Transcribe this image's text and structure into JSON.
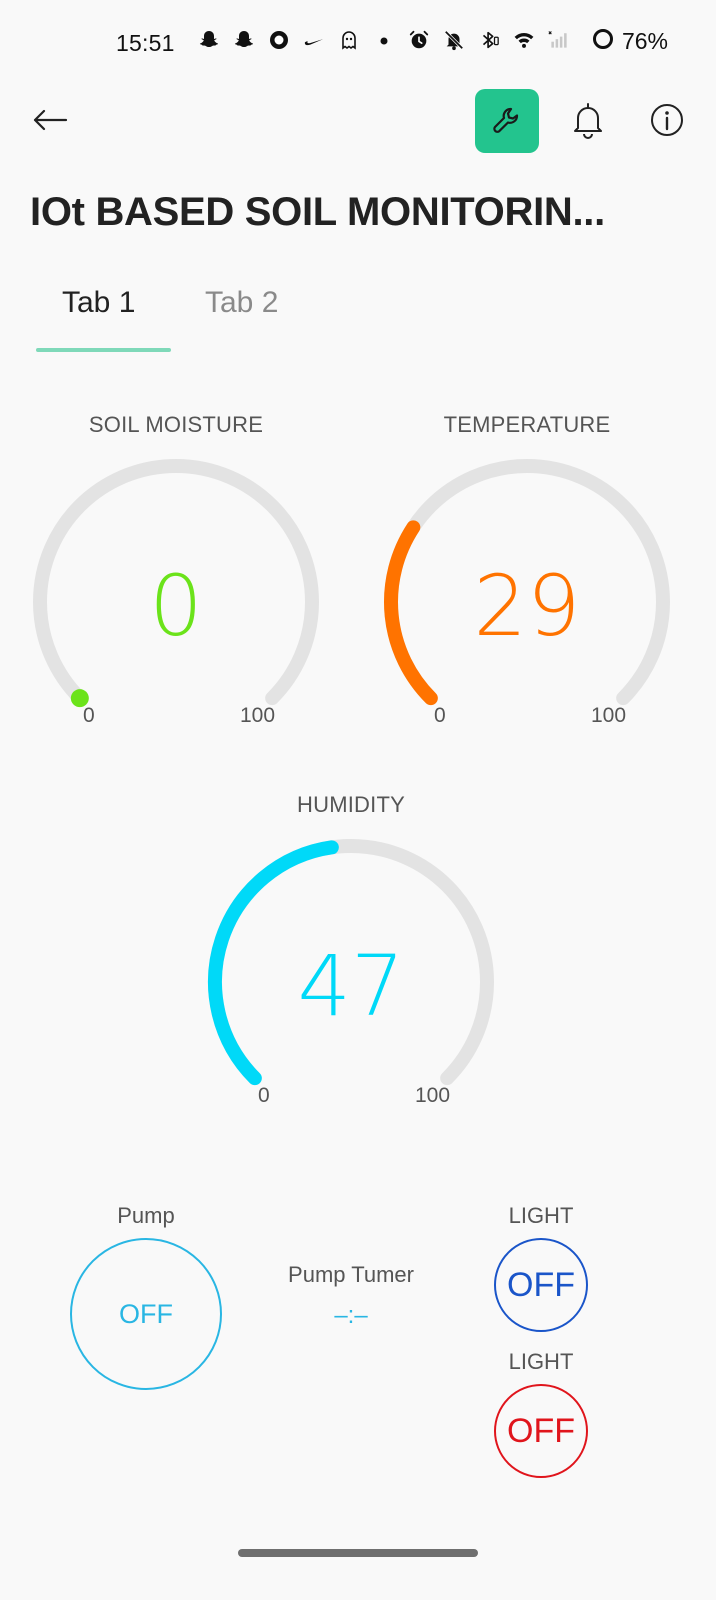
{
  "status_bar": {
    "time": "15:51",
    "battery": "76%",
    "icons": [
      "snapchat-icon",
      "snapchat-icon",
      "circle-app-icon",
      "nike-icon",
      "ghost-icon",
      "dot-icon",
      "alarm-icon",
      "bell-off-icon",
      "bluetooth-icon",
      "wifi-icon",
      "signal-icon",
      "battery-ring-icon"
    ]
  },
  "header": {
    "title": "IOt BASED SOIL MONITORIN...",
    "accent_color": "#23c48e"
  },
  "tabs": [
    {
      "label": "Tab 1",
      "active": true
    },
    {
      "label": "Tab 2",
      "active": false
    }
  ],
  "gauges": {
    "soil": {
      "label": "SOIL MOISTURE",
      "value": "0",
      "min": "0",
      "max": "100",
      "color": "#6be31a"
    },
    "temperature": {
      "label": "TEMPERATURE",
      "value": "29",
      "min": "0",
      "max": "100",
      "color": "#ff7300"
    },
    "humidity": {
      "label": "HUMIDITY",
      "value": "47",
      "min": "0",
      "max": "100",
      "color": "#00d9f8"
    }
  },
  "controls": {
    "pump": {
      "label": "Pump",
      "state": "OFF",
      "color": "#29b6e3"
    },
    "pump_timer": {
      "label": "Pump Tumer",
      "value": "–:–",
      "color": "#29b6e3"
    },
    "light1": {
      "label": "LIGHT",
      "state": "OFF",
      "color": "#1a55c9"
    },
    "light2": {
      "label": "LIGHT",
      "state": "OFF",
      "color": "#e0151c"
    }
  }
}
